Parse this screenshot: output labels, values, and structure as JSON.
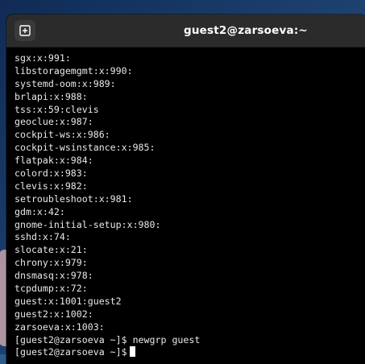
{
  "window": {
    "title": "guest2@zarsoeva:~"
  },
  "terminal": {
    "lines": [
      "sgx:x:991:",
      "libstoragemgmt:x:990:",
      "systemd-oom:x:989:",
      "brlapi:x:988:",
      "tss:x:59:clevis",
      "geoclue:x:987:",
      "cockpit-ws:x:986:",
      "cockpit-wsinstance:x:985:",
      "flatpak:x:984:",
      "colord:x:983:",
      "clevis:x:982:",
      "setroubleshoot:x:981:",
      "gdm:x:42:",
      "gnome-initial-setup:x:980:",
      "sshd:x:74:",
      "slocate:x:21:",
      "chrony:x:979:",
      "dnsmasq:x:978:",
      "tcpdump:x:72:",
      "guest:x:1001:guest2",
      "guest2:x:1002:",
      "zarsoeva:x:1003:",
      "[guest2@zarsoeva ~]$ newgrp guest",
      "[guest2@zarsoeva ~]$"
    ]
  },
  "icons": {
    "new_tab": "new-tab-icon"
  }
}
